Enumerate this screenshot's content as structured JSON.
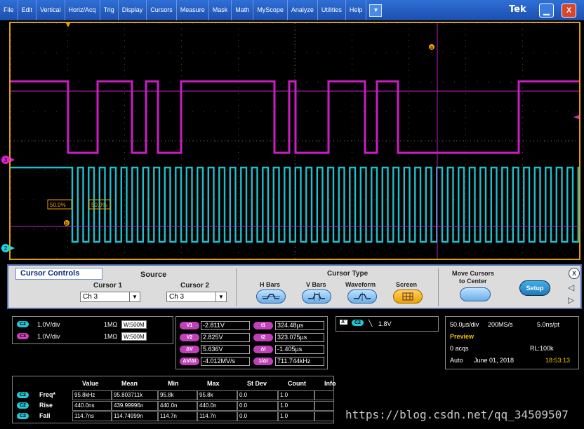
{
  "menu": {
    "items": [
      "File",
      "Edit",
      "Vertical",
      "Horiz/Acq",
      "Trig",
      "Display",
      "Cursors",
      "Measure",
      "Mask",
      "Math",
      "MyScope",
      "Analyze",
      "Utilities",
      "Help"
    ],
    "dropdown_icon": "chevron-down-icon",
    "logo": "Tek",
    "minimize_icon": "minimize-icon",
    "close_icon": "close-icon"
  },
  "scope": {
    "cursor_a_label": "a",
    "cursor_b_label": "b",
    "ch3_marker": "3",
    "ch2_marker": "2",
    "ref_label_1": "50.0%",
    "ref_label_2": "50.0%",
    "colors": {
      "ch2": "#22d3e0",
      "ch3": "#e020d8",
      "cursor": "#c020c8",
      "trigger": "#f0a000"
    }
  },
  "cursor_controls": {
    "title": "Cursor Controls",
    "source_label": "Source",
    "cursor1_label": "Cursor 1",
    "cursor1_value": "Ch 3",
    "cursor2_label": "Cursor 2",
    "cursor2_value": "Ch 3",
    "cursor_type_label": "Cursor Type",
    "types": [
      "H Bars",
      "V Bars",
      "Waveform",
      "Screen"
    ],
    "selected_type": "Screen",
    "move_label_1": "Move Cursors",
    "move_label_2": "to Center",
    "setup_label": "Setup"
  },
  "channels": [
    {
      "badge": "C2",
      "scale": "1.0V/div",
      "impedance": "1MΩ",
      "bw": "W:500M"
    },
    {
      "badge": "C3",
      "scale": "1.0V/div",
      "impedance": "1MΩ",
      "bw": "W:500M"
    }
  ],
  "cursor_readout": {
    "v1_label": "V1",
    "v1": "-2.811V",
    "v2_label": "V2",
    "v2": "2.825V",
    "dv_label": "ΔV",
    "dv": "5.636V",
    "dvdt_label": "ΔV/Δt",
    "dvdt": "-4.012MV/s",
    "t1_label": "t1",
    "t1": "324.48µs",
    "t2_label": "t2",
    "t2": "323.075µs",
    "dt_label": "Δt",
    "dt": "-1.405µs",
    "inv_dt_label": "1/Δt",
    "inv_dt": "711.744kHz"
  },
  "trigger": {
    "source": "A'",
    "channel": "C2",
    "level": "1.8V"
  },
  "acquisition": {
    "timebase": "50.0µs/div",
    "sample_rate": "200MS/s",
    "resolution": "5.0ns/pt",
    "mode": "Preview",
    "acqs": "0 acqs",
    "record_length": "RL:100k",
    "trigger_mode": "Auto",
    "date": "June 01, 2018",
    "time": "18:53:13"
  },
  "measurements": {
    "headers": [
      "Value",
      "Mean",
      "Min",
      "Max",
      "St Dev",
      "Count",
      "Info"
    ],
    "rows": [
      {
        "badge": "C2",
        "name": "Freq*",
        "cells": [
          "95.8kHz",
          "95.803711k",
          "95.8k",
          "95.8k",
          "0.0",
          "1.0",
          ""
        ]
      },
      {
        "badge": "C2",
        "name": "Rise",
        "cells": [
          "440.0ns",
          "439.99996n",
          "440.0n",
          "440.0n",
          "0.0",
          "1.0",
          ""
        ]
      },
      {
        "badge": "C2",
        "name": "Fall",
        "cells": [
          "114.7ns",
          "114.74999n",
          "114.7n",
          "114.7n",
          "0.0",
          "1.0",
          ""
        ]
      }
    ]
  },
  "watermark": "https://blog.csdn.net/qq_34509507"
}
